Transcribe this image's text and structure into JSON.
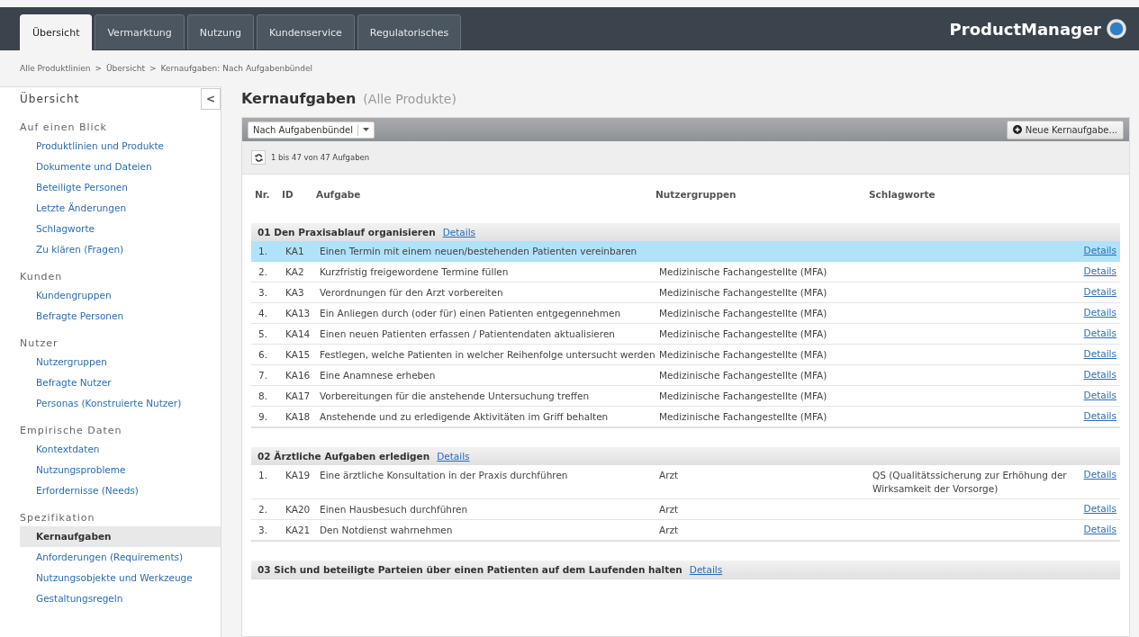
{
  "header": {
    "tabs": [
      {
        "label": "Übersicht",
        "selected": true
      },
      {
        "label": "Vermarktung",
        "selected": false
      },
      {
        "label": "Nutzung",
        "selected": false
      },
      {
        "label": "Kundenservice",
        "selected": false
      },
      {
        "label": "Regulatorisches",
        "selected": false
      }
    ],
    "brand": "ProductManager"
  },
  "breadcrumb": [
    "Alle Produktlinien",
    "Übersicht",
    "Kernaufgaben: Nach Aufgabenbündel"
  ],
  "breadcrumb_separator": ">",
  "sidebar": {
    "title": "Übersicht",
    "collapse_label": "<",
    "sections": [
      {
        "title": "Auf einen Blick",
        "items": [
          {
            "label": "Produktlinien und Produkte",
            "selected": false
          },
          {
            "label": "Dokumente und Dateien",
            "selected": false
          },
          {
            "label": "Beteiligte Personen",
            "selected": false
          },
          {
            "label": "Letzte Änderungen",
            "selected": false
          },
          {
            "label": "Schlagworte",
            "selected": false
          },
          {
            "label": "Zu klären (Fragen)",
            "selected": false
          }
        ]
      },
      {
        "title": "Kunden",
        "items": [
          {
            "label": "Kundengruppen",
            "selected": false
          },
          {
            "label": "Befragte Personen",
            "selected": false
          }
        ]
      },
      {
        "title": "Nutzer",
        "items": [
          {
            "label": "Nutzergruppen",
            "selected": false
          },
          {
            "label": "Befragte Nutzer",
            "selected": false
          },
          {
            "label": "Personas (Konstruierte Nutzer)",
            "selected": false
          }
        ]
      },
      {
        "title": "Empirische Daten",
        "items": [
          {
            "label": "Kontextdaten",
            "selected": false
          },
          {
            "label": "Nutzungsprobleme",
            "selected": false
          },
          {
            "label": "Erfordernisse (Needs)",
            "selected": false
          }
        ]
      },
      {
        "title": "Spezifikation",
        "items": [
          {
            "label": "Kernaufgaben",
            "selected": true
          },
          {
            "label": "Anforderungen (Requirements)",
            "selected": false
          },
          {
            "label": "Nutzungsobjekte und Werkzeuge",
            "selected": false
          },
          {
            "label": "Gestaltungsregeln",
            "selected": false
          }
        ]
      }
    ]
  },
  "page": {
    "title": "Kernaufgaben",
    "subtitle": "(Alle Produkte)"
  },
  "toolbar": {
    "dropdown": "Nach Aufgabenbündel",
    "new_button": "Neue Kernaufgabe...",
    "count": "1 bis 47 von 47 Aufgaben"
  },
  "table": {
    "columns": [
      "Nr.",
      "ID",
      "Aufgabe",
      "Nutzergruppen",
      "Schlagworte"
    ],
    "groups": [
      {
        "title": "01 Den Praxisablauf organisieren",
        "link": "Details",
        "rows": [
          {
            "nr": "1.",
            "id": "KA1",
            "task": "Einen Termin mit einem neuen/bestehenden Patienten vereinbaren",
            "link": "Details",
            "selected": true
          },
          {
            "nr": "2.",
            "id": "KA2",
            "task": "Kurzfristig freigewordene Termine füllen",
            "users": "Medizinische Fachangestellte (MFA)",
            "link": "Details",
            "selected": false
          },
          {
            "nr": "3.",
            "id": "KA3",
            "task": "Verordnungen für den Arzt vorbereiten",
            "users": "Medizinische Fachangestellte (MFA)",
            "link": "Details",
            "selected": false
          },
          {
            "nr": "4.",
            "id": "KA13",
            "task": "Ein Anliegen durch (oder für) einen Patienten entgegennehmen",
            "users": "Medizinische Fachangestellte (MFA)",
            "link": "Details",
            "selected": false
          },
          {
            "nr": "5.",
            "id": "KA14",
            "task": "Einen neuen Patienten erfassen / Patientendaten aktualisieren",
            "users": "Medizinische Fachangestellte (MFA)",
            "link": "Details",
            "selected": false
          },
          {
            "nr": "6.",
            "id": "KA15",
            "task": "Festlegen, welche Patienten in welcher Reihenfolge untersucht werden",
            "users": "Medizinische Fachangestellte (MFA)",
            "link": "Details",
            "selected": false
          },
          {
            "nr": "7.",
            "id": "KA16",
            "task": "Eine Anamnese erheben",
            "users": "Medizinische Fachangestellte (MFA)",
            "link": "Details",
            "selected": false
          },
          {
            "nr": "8.",
            "id": "KA17",
            "task": "Vorbereitungen für die anstehende Untersuchung treffen",
            "users": "Medizinische Fachangestellte (MFA)",
            "link": "Details",
            "selected": false
          },
          {
            "nr": "9.",
            "id": "KA18",
            "task": "Anstehende und zu erledigende Aktivitäten im Griff behalten",
            "users": "Medizinische Fachangestellte (MFA)",
            "link": "Details",
            "selected": false
          }
        ]
      },
      {
        "title": "02 Ärztliche Aufgaben erledigen",
        "link": "Details",
        "rows": [
          {
            "nr": "1.",
            "id": "KA19",
            "task": "Eine ärztliche Konsultation in der Praxis durchführen",
            "users": "Arzt",
            "tags": "QS (Qualitätssicherung zur Erhöhung der Wirksamkeit der Vorsorge)",
            "link": "Details",
            "selected": false
          },
          {
            "nr": "2.",
            "id": "KA20",
            "task": "Einen Hausbesuch durchführen",
            "users": "Arzt",
            "link": "Details",
            "selected": false
          },
          {
            "nr": "3.",
            "id": "KA21",
            "task": "Den Notdienst wahrnehmen",
            "users": "Arzt",
            "link": "Details",
            "selected": false
          }
        ]
      },
      {
        "title": "03 Sich und beteiligte Parteien über einen Patienten auf dem Laufenden halten",
        "link": "Details"
      }
    ]
  }
}
